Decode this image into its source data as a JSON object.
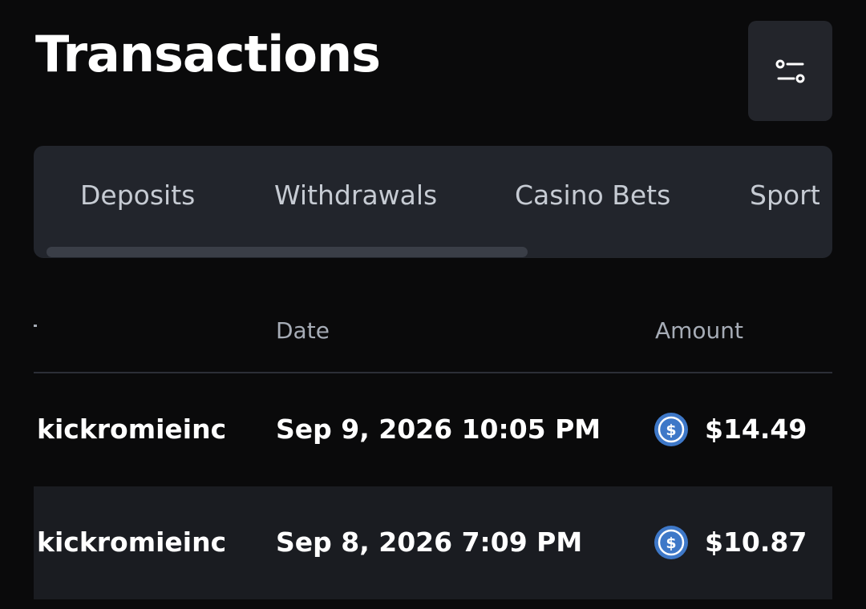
{
  "header": {
    "title": "Transactions",
    "filter_icon": "sliders-icon"
  },
  "tabs": [
    {
      "label": "Deposits"
    },
    {
      "label": "Withdrawals"
    },
    {
      "label": "Casino Bets"
    },
    {
      "label": "Sport"
    }
  ],
  "table": {
    "columns": [
      "Date",
      "Amount"
    ],
    "rows": [
      {
        "user": "kickromieinc",
        "date": "Sep 9, 2026 10:05 PM",
        "currency_icon": "usdc-coin-icon",
        "amount": "$14.49"
      },
      {
        "user": "kickromieinc",
        "date": "Sep 8, 2026 7:09 PM",
        "currency_icon": "usdc-coin-icon",
        "amount": "$10.87"
      }
    ]
  },
  "colors": {
    "background": "#0a0a0b",
    "panel": "#22252c",
    "alt_row": "#1a1c21",
    "coin": "#3e78c8"
  }
}
